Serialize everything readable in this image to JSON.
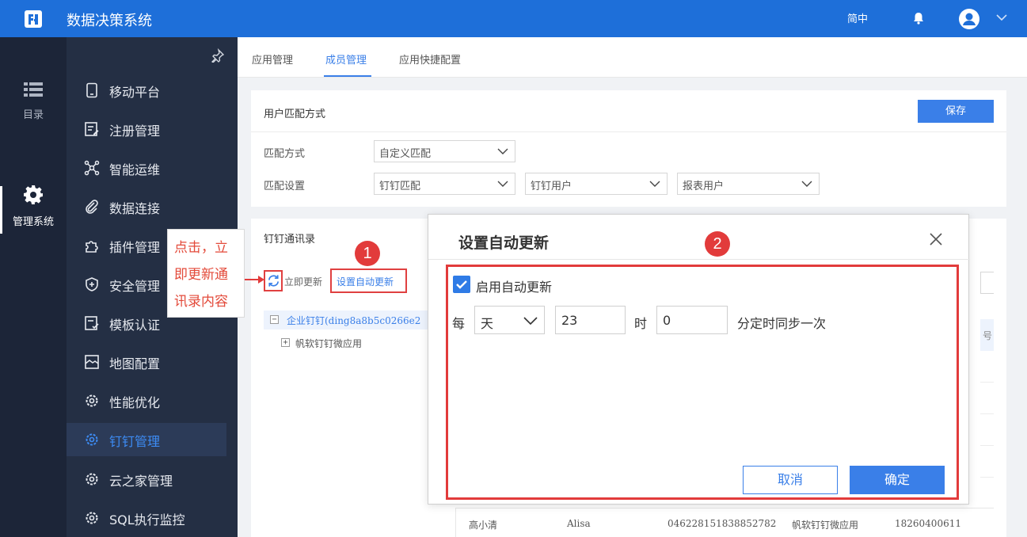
{
  "header": {
    "app_title": "数据决策系统",
    "language": "简中"
  },
  "rail": {
    "items": [
      {
        "label": "目录",
        "icon": "list-icon"
      },
      {
        "label": "管理系统",
        "icon": "gear-icon"
      }
    ]
  },
  "sidebar": {
    "items": [
      {
        "label": "移动平台",
        "icon": "mobile-icon"
      },
      {
        "label": "注册管理",
        "icon": "register-icon"
      },
      {
        "label": "智能运维",
        "icon": "network-icon"
      },
      {
        "label": "数据连接",
        "icon": "link-icon"
      },
      {
        "label": "插件管理",
        "icon": "puzzle-icon"
      },
      {
        "label": "安全管理",
        "icon": "shield-icon"
      },
      {
        "label": "模板认证",
        "icon": "template-icon"
      },
      {
        "label": "地图配置",
        "icon": "map-icon"
      },
      {
        "label": "性能优化",
        "icon": "gear-icon"
      },
      {
        "label": "钉钉管理",
        "icon": "gear-icon",
        "active": true
      },
      {
        "label": "云之家管理",
        "icon": "gear-icon"
      },
      {
        "label": "SQL执行监控",
        "icon": "gear-icon"
      }
    ]
  },
  "tabs": [
    {
      "label": "应用管理"
    },
    {
      "label": "成员管理",
      "active": true
    },
    {
      "label": "应用快捷配置"
    }
  ],
  "match_card": {
    "title": "用户匹配方式",
    "save_label": "保存",
    "method_label": "匹配方式",
    "method_value": "自定义匹配",
    "setting_label": "匹配设置",
    "setting_values": [
      "钉钉匹配",
      "钉钉用户",
      "报表用户"
    ]
  },
  "contacts_card": {
    "title": "钉钉通讯录",
    "refresh_label": "立即更新",
    "auto_update_label": "设置自动更新",
    "tree": [
      {
        "toggle": "−",
        "label": "企业钉钉(ding8a8b5c0266e2"
      },
      {
        "toggle": "+",
        "label": "帆软钉钉微应用"
      }
    ],
    "partial_header_char": "号"
  },
  "data_row": {
    "name": "高小清",
    "alias": "Alisa",
    "id": "046228151838852782",
    "app": "帆软钉钉微应用",
    "phone": "18260400611"
  },
  "callout": {
    "text": "点击，立即更新通讯录内容"
  },
  "badges": [
    "1",
    "2"
  ],
  "modal": {
    "title": "设置自动更新",
    "enable_label": "启用自动更新",
    "enabled": true,
    "every_label": "每",
    "unit_value": "天",
    "hour_value": "23",
    "hour_label": "时",
    "minute_value": "0",
    "suffix_label": "分定时同步一次",
    "cancel_label": "取消",
    "ok_label": "确定"
  },
  "colors": {
    "primary": "#1e6fd9",
    "accent": "#3a7fe8",
    "annotation_red": "#e23b3b",
    "rail_bg": "#1c2538",
    "sidebar_bg": "#242f44"
  }
}
